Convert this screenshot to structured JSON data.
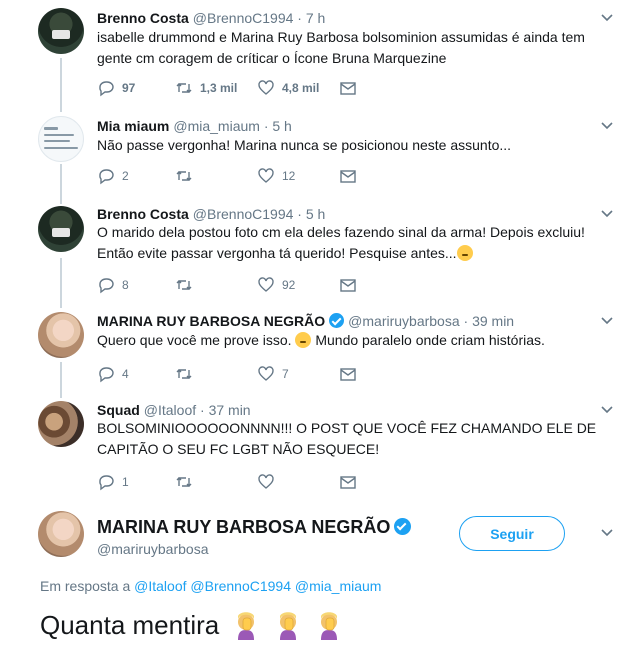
{
  "tweets": [
    {
      "name": "Brenno Costa",
      "handle": "@BrennoC1994 · 7 h",
      "lines": [
        "isabelle drummond e Marina Ruy Barbosa bolsominion assumidas é ainda tem",
        "gente cm coragem de críticar o Ícone Bruna Marquezine"
      ],
      "replies": "97",
      "retweets": "1,3 mil",
      "likes": "4,8 mil"
    },
    {
      "name": "Mia miaum",
      "handle": "@mia_miaum · 5 h",
      "lines": [
        "Não passe vergonha! Marina nunca se posicionou neste assunto..."
      ],
      "replies": "2",
      "retweets": "",
      "likes": "12"
    },
    {
      "name": "Brenno Costa",
      "handle": "@BrennoC1994 · 5 h",
      "lines": [
        "O marido dela postou foto cm ela deles fazendo sinal da arma! Depois excluiu!",
        "Então evite passar vergonha tá querido! Pesquise antes..."
      ],
      "replies": "8",
      "retweets": "",
      "likes": "92"
    },
    {
      "name": "MARINA RUY BARBOSA NEGRÃO",
      "handle": "@mariruybarbosa · 39 min",
      "lines": [
        "Quero que você me prove isso.",
        "Mundo paralelo onde criam histórias."
      ],
      "replies": "4",
      "retweets": "",
      "likes": "7"
    },
    {
      "name": "Squad",
      "handle": "@Italoof · 37 min",
      "lines": [
        "BOLSOMINIOOOOOONNNN!!! O POST QUE VOCÊ FEZ CHAMANDO ELE DE",
        "CAPITÃO O SEU FC LGBT NÃO ESQUECE!"
      ],
      "replies": "1",
      "retweets": "",
      "likes": ""
    }
  ],
  "focus": {
    "name": "MARINA RUY BARBOSA NEGRÃO",
    "handle": "@mariruybarbosa",
    "follow_label": "Seguir",
    "reply_prefix": "Em resposta a",
    "reply_handles": "@Italoof @BrennoC1994 @mia_miaum",
    "text": "Quanta mentira"
  },
  "colors": {
    "accent": "#1da1f2",
    "muted": "#657786",
    "line": "#ccd6dd"
  },
  "icons": [
    "reply-icon",
    "retweet-icon",
    "like-icon",
    "direct-message-icon",
    "chevron-down-icon",
    "verified-badge-icon",
    "facepalm-emoji"
  ]
}
